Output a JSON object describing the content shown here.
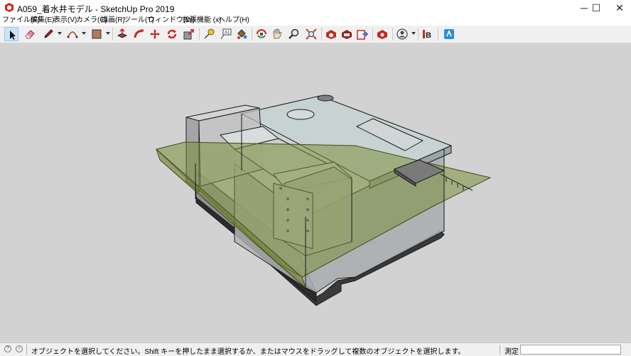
{
  "window": {
    "title": "A059_着水井モデル - SketchUp Pro 2019",
    "minimize_glyph": "─",
    "maximize_glyph": "☐",
    "close_glyph": "✕"
  },
  "menu": [
    "ファイル(F)",
    "編集(E)",
    "表示(V)",
    "カメラ(C)",
    "描画(R)",
    "ツール(T)",
    "ウィンドウ(W)",
    "拡張機能 (x)",
    "ヘルプ(H)"
  ],
  "toolbar": {
    "tools": [
      "select-icon",
      "eraser-icon",
      "pencil-icon",
      "arc-icon",
      "rectangle-icon",
      "push-pull-icon",
      "follow-me-icon",
      "move-icon",
      "rotate-icon",
      "scale-icon",
      "tape-measure-icon",
      "text-icon",
      "paint-bucket-icon",
      "orbit-icon",
      "pan-icon",
      "zoom-icon",
      "zoom-extents-icon",
      "warehouse-icon",
      "extension-warehouse-icon",
      "send-to-layout-icon",
      "extension-manager-icon",
      "account-icon",
      "3b-icon",
      "classifier-icon"
    ]
  },
  "status": {
    "message": "オブジェクトを選択してください。Shift キーを押したまま選択するか、またはマウスをドラッグして複数のオブジェクトを選択します。",
    "measure_label": "測定",
    "measure_value": ""
  },
  "colors": {
    "viewport_bg": "#d2d2d2",
    "ground_plane": "#7c8f3c",
    "structure_edge": "#1a1a1a",
    "glass": "#c8d8d8"
  }
}
